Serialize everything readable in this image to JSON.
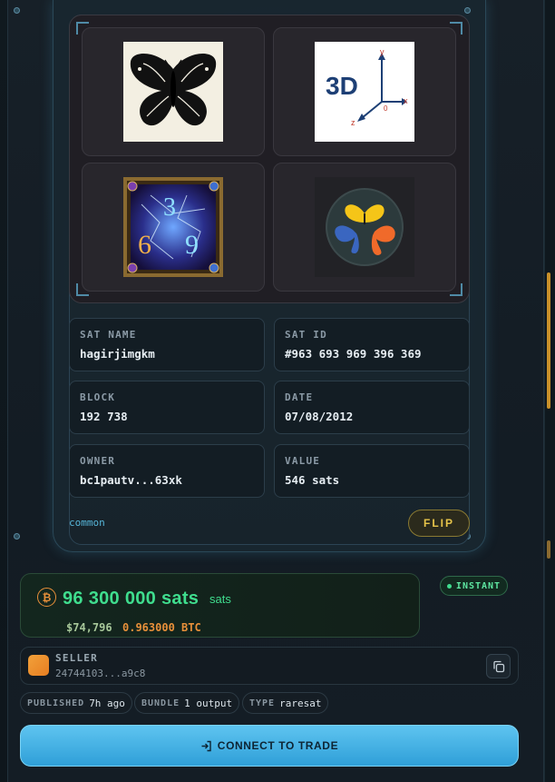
{
  "inscriptions": [
    {
      "name": "black-butterfly"
    },
    {
      "name": "3d-axes",
      "text": "3D",
      "axes": [
        "y",
        "x",
        "z",
        "0"
      ]
    },
    {
      "name": "369-card",
      "text": [
        "3",
        "6",
        "9"
      ]
    },
    {
      "name": "butterflies-badge"
    }
  ],
  "sat": {
    "name_label": "SAT NAME",
    "name_value": "hagirjimgkm",
    "id_label": "SAT ID",
    "id_value": "#963 693 969 396 369",
    "block_label": "BLOCK",
    "block_value": "192 738",
    "date_label": "DATE",
    "date_value": "07/08/2012",
    "owner_label": "OWNER",
    "owner_value": "bc1pautv...63xk",
    "value_label": "VALUE",
    "value_value": "546 sats"
  },
  "rarity": "common",
  "flip_label": "FLIP",
  "price": {
    "btc_symbol": "₿",
    "amount": "96 300 000",
    "amount_unit": "sats",
    "unit_small": "sats",
    "usd": "$74,796",
    "btc": "0.963000 BTC"
  },
  "instant_label": "INSTANT",
  "seller": {
    "label": "SELLER",
    "address": "24744103...a9c8"
  },
  "tags": [
    {
      "key": "PUBLISHED",
      "value": "7h ago"
    },
    {
      "key": "BUNDLE",
      "value": "1 output"
    },
    {
      "key": "TYPE",
      "value": "raresat"
    }
  ],
  "connect_label": "CONNECT TO TRADE",
  "colors": {
    "accent": "#3fdd8e",
    "btc_orange": "#e8903a",
    "button_blue": "#3aa9e0",
    "flip_gold": "#e7c44a"
  }
}
